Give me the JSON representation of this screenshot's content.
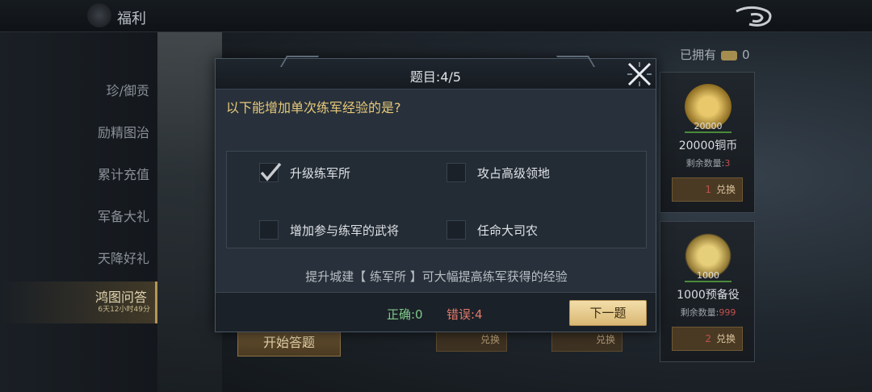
{
  "header": {
    "title": "福利"
  },
  "sidebar": {
    "items": [
      {
        "label": "珍/御贡"
      },
      {
        "label": "励精图治"
      },
      {
        "label": "累计充值"
      },
      {
        "label": "军备大礼"
      },
      {
        "label": "天降好礼"
      },
      {
        "label": "鸿图问答",
        "sub": "6天12小时49分"
      }
    ]
  },
  "shop": {
    "owned_label": "已拥有",
    "owned_count": "0",
    "cards": [
      {
        "qty": "20000",
        "name": "20000铜币",
        "remain_label": "剩余数量:",
        "remain_value": "3",
        "cost": "1",
        "button": "兑换"
      },
      {
        "qty": "1000",
        "name": "1000预备役",
        "remain_label": "剩余数量:",
        "remain_value": "999",
        "cost": "2",
        "button": "兑换"
      }
    ],
    "ghost_buttons": [
      "兑换",
      "兑换"
    ]
  },
  "start_button": "开始答题",
  "dialog": {
    "title": "题目:4/5",
    "question": "以下能增加单次练军经验的是?",
    "options": [
      {
        "label": "升级练军所",
        "checked": true
      },
      {
        "label": "攻占高级领地",
        "checked": false
      },
      {
        "label": "增加参与练军的武将",
        "checked": false
      },
      {
        "label": "任命大司农",
        "checked": false
      }
    ],
    "hint": "提升城建【 练军所 】可大幅提高练军获得的经验",
    "correct": "正确:0",
    "wrong": "错误:4",
    "next_button": "下一题"
  },
  "colors": {
    "accent_gold": "#e8c97a",
    "correct_green": "#7fc98a",
    "wrong_red": "#e07a6a",
    "button_gold": "#d9b874"
  }
}
